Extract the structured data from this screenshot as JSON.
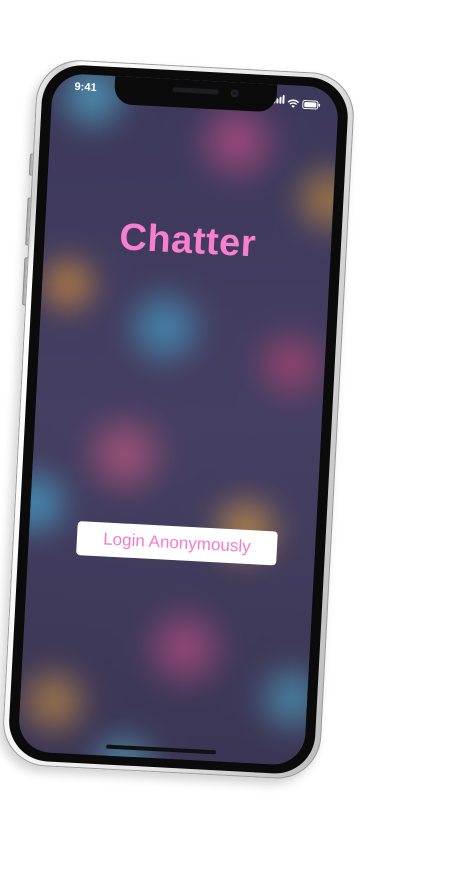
{
  "status_bar": {
    "time": "9:41"
  },
  "app": {
    "title": "Chatter",
    "title_color": "#f77fd0"
  },
  "login": {
    "label": "Login Anonymously",
    "text_color": "#f27ccc",
    "background": "#ffffff"
  },
  "icons": {
    "signal": "cellular-signal-icon",
    "wifi": "wifi-icon",
    "battery": "battery-icon"
  }
}
